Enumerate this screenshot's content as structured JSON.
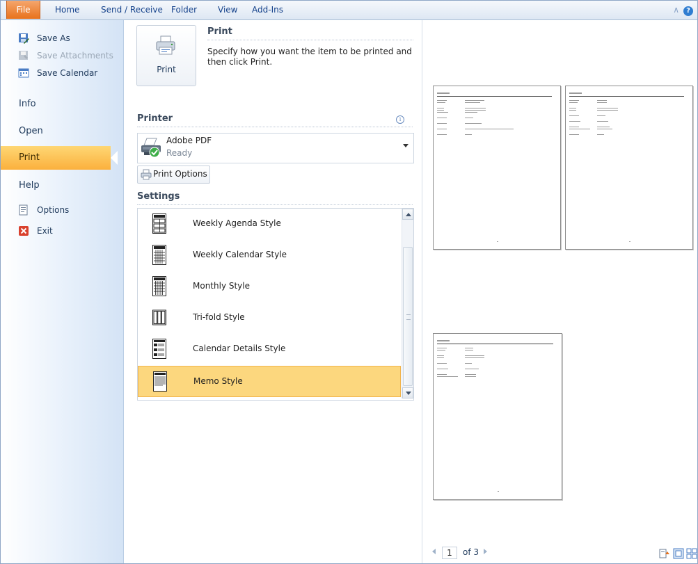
{
  "ribbon": {
    "tabs": [
      "File",
      "Home",
      "Send / Receive",
      "Folder",
      "View",
      "Add-Ins"
    ]
  },
  "nav": {
    "save_as": "Save As",
    "save_attachments": "Save Attachments",
    "save_calendar": "Save Calendar",
    "info": "Info",
    "open": "Open",
    "print": "Print",
    "help": "Help",
    "options": "Options",
    "exit": "Exit"
  },
  "print_section": {
    "button_label": "Print",
    "title": "Print",
    "description": "Specify how you want the item to be printed and then click Print."
  },
  "printer": {
    "heading": "Printer",
    "name": "Adobe PDF",
    "status": "Ready",
    "options_button": "Print Options"
  },
  "settings": {
    "heading": "Settings",
    "styles": [
      {
        "label": "Weekly Agenda Style",
        "icon": "weekly-agenda-style-icon",
        "selected": false
      },
      {
        "label": "Weekly Calendar Style",
        "icon": "weekly-calendar-style-icon",
        "selected": false
      },
      {
        "label": "Monthly Style",
        "icon": "monthly-style-icon",
        "selected": false
      },
      {
        "label": "Tri-fold Style",
        "icon": "tri-fold-style-icon",
        "selected": false
      },
      {
        "label": "Calendar Details Style",
        "icon": "calendar-details-style-icon",
        "selected": false
      },
      {
        "label": "Memo Style",
        "icon": "memo-style-icon",
        "selected": true
      }
    ]
  },
  "preview": {
    "current_page": "1",
    "of_text": "of 3"
  },
  "colors": {
    "file_tab": "#e8721c",
    "selected_row": "#fcd77e",
    "active_nav": "#fbb03d"
  }
}
